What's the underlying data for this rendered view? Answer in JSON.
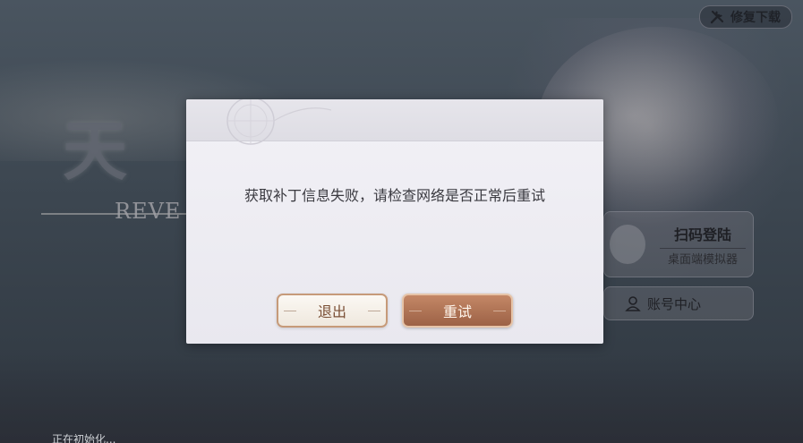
{
  "background": {
    "logo_text": "天",
    "logo_sub": "REVE"
  },
  "toolbar": {
    "repair_label": "修复下载",
    "repair_icon": "wrench-screwdriver-icon"
  },
  "side_panel": {
    "qr_title": "扫码登陆",
    "qr_subtitle": "桌面端模拟器",
    "account_label": "账号中心",
    "account_icon": "user-icon"
  },
  "status": {
    "text": "正在初始化..."
  },
  "dialog": {
    "message": "获取补丁信息失败，请检查网络是否正常后重试",
    "exit_label": "退出",
    "retry_label": "重试"
  },
  "colors": {
    "exit_border": "#c69a79",
    "retry_fill": "#b07354",
    "dialog_bg": "#eeedf3"
  }
}
